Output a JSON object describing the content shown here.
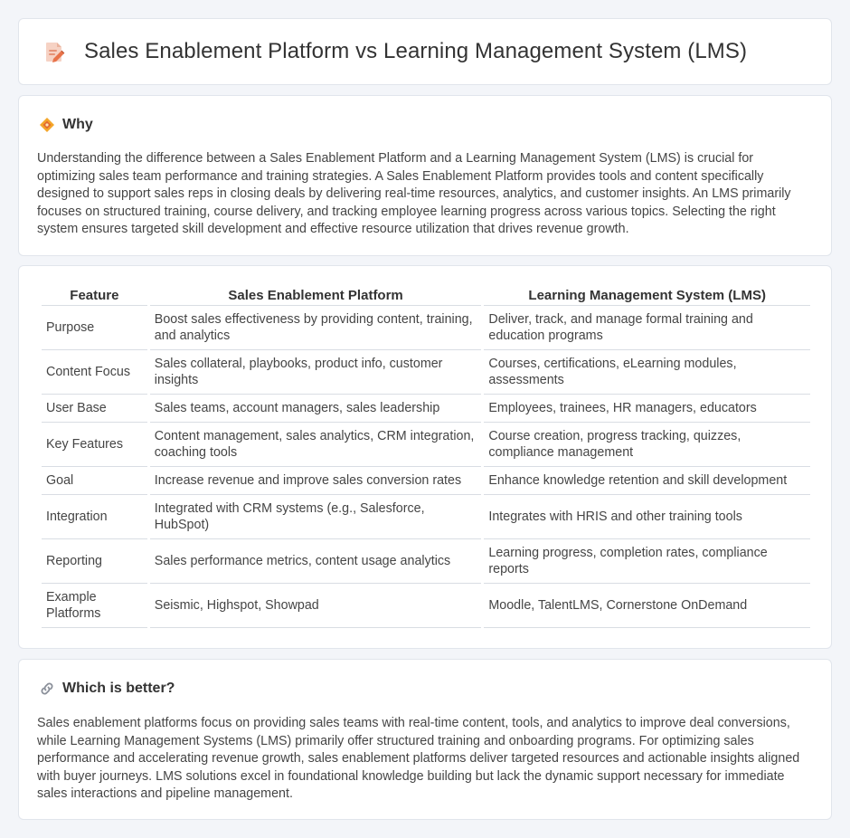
{
  "header": {
    "title": "Sales Enablement Platform vs Learning Management System (LMS)",
    "icon": "document-pencil-icon"
  },
  "why": {
    "heading": "Why",
    "icon": "diamond-icon",
    "text": "Understanding the difference between a Sales Enablement Platform and a Learning Management System (LMS) is crucial for optimizing sales team performance and training strategies. A Sales Enablement Platform provides tools and content specifically designed to support sales reps in closing deals by delivering real-time resources, analytics, and customer insights. An LMS primarily focuses on structured training, course delivery, and tracking employee learning progress across various topics. Selecting the right system ensures targeted skill development and effective resource utilization that drives revenue growth."
  },
  "table": {
    "headers": [
      "Feature",
      "Sales Enablement Platform",
      "Learning Management System (LMS)"
    ],
    "rows": [
      [
        "Purpose",
        "Boost sales effectiveness by providing content, training, and analytics",
        "Deliver, track, and manage formal training and education programs"
      ],
      [
        "Content Focus",
        "Sales collateral, playbooks, product info, customer insights",
        "Courses, certifications, eLearning modules, assessments"
      ],
      [
        "User Base",
        "Sales teams, account managers, sales leadership",
        "Employees, trainees, HR managers, educators"
      ],
      [
        "Key Features",
        "Content management, sales analytics, CRM integration, coaching tools",
        "Course creation, progress tracking, quizzes, compliance management"
      ],
      [
        "Goal",
        "Increase revenue and improve sales conversion rates",
        "Enhance knowledge retention and skill development"
      ],
      [
        "Integration",
        "Integrated with CRM systems (e.g., Salesforce, HubSpot)",
        "Integrates with HRIS and other training tools"
      ],
      [
        "Reporting",
        "Sales performance metrics, content usage analytics",
        "Learning progress, completion rates, compliance reports"
      ],
      [
        "Example Platforms",
        "Seismic, Highspot, Showpad",
        "Moodle, TalentLMS, Cornerstone OnDemand"
      ]
    ]
  },
  "better": {
    "heading": "Which is better?",
    "icon": "link-icon",
    "text": "Sales enablement platforms focus on providing sales teams with real-time content, tools, and analytics to improve deal conversions, while Learning Management Systems (LMS) primarily offer structured training and onboarding programs. For optimizing sales performance and accelerating revenue growth, sales enablement platforms deliver targeted resources and actionable insights aligned with buyer journeys. LMS solutions excel in foundational knowledge building but lack the dynamic support necessary for immediate sales interactions and pipeline management."
  },
  "colors": {
    "background": "#f3f5f9",
    "card": "#ffffff",
    "border": "#e1e5ec",
    "icon_accent": "#e8734a",
    "diamond_accent": "#f4a62a"
  }
}
